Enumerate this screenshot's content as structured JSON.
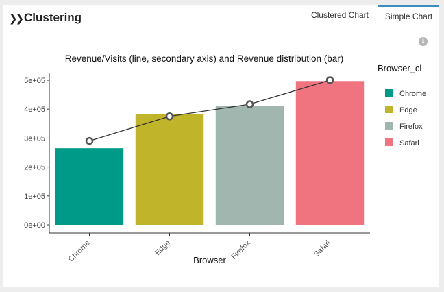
{
  "panel": {
    "title": "Clustering",
    "collapse_icon": "double-chevron-right-icon",
    "info_icon": "info-icon"
  },
  "tabs": [
    {
      "label": "Clustered Chart",
      "active": false
    },
    {
      "label": "Simple Chart",
      "active": true
    }
  ],
  "chart_data": {
    "type": "bar",
    "title": "Revenue/Visits (line, secondary axis) and Revenue distribution (bar)",
    "xlabel": "Browser",
    "ylabel": "",
    "categories": [
      "Chrome",
      "Edge",
      "Firefox",
      "Safari"
    ],
    "values": [
      265000,
      382000,
      410000,
      497000
    ],
    "colors": [
      "#009b88",
      "#c0b42b",
      "#a0b6ae",
      "#f07380"
    ],
    "ylim": [
      0,
      500000
    ],
    "yticks": [
      "0e+00",
      "1e+05",
      "2e+05",
      "3e+05",
      "4e+05",
      "5e+05"
    ],
    "ytick_values": [
      0,
      100000,
      200000,
      300000,
      400000,
      500000
    ],
    "line": {
      "secondary_axis": true,
      "values": [
        290000,
        375000,
        417000,
        500000
      ],
      "color": "#333333"
    },
    "legend": {
      "title": "Browser_cl",
      "placement": "right",
      "entries": [
        "Chrome",
        "Edge",
        "Firefox",
        "Safari"
      ]
    },
    "grid": false
  }
}
